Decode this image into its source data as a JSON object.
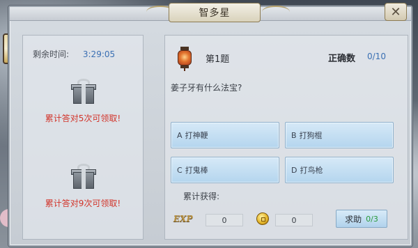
{
  "window": {
    "title": "智多星",
    "close_glyph": "✕"
  },
  "left_panel": {
    "timer_label": "剩余时间:",
    "timer_value": "3:29:05",
    "rewards": [
      {
        "icon": "gift-box-icon",
        "text": "累计答对5次可领取!"
      },
      {
        "icon": "silver-gift-box-icon",
        "text": "累计答对9次可领取!"
      }
    ]
  },
  "question": {
    "icon": "lantern-icon",
    "number_label": "第1题",
    "correct_label": "正确数",
    "correct_value": "0/10",
    "text": "姜子牙有什么法宝?"
  },
  "answers": [
    {
      "letter": "A",
      "text": "打神鞭"
    },
    {
      "letter": "B",
      "text": "打狗棍"
    },
    {
      "letter": "C",
      "text": "打鬼棒"
    },
    {
      "letter": "D",
      "text": "打鸟枪"
    }
  ],
  "accumulated": {
    "label": "累计获得:",
    "exp_label": "EXP",
    "exp_value": "0",
    "coin_icon": "copper-coin-icon",
    "coin_value": "0"
  },
  "help_button": {
    "label": "求助",
    "count": "0/3"
  },
  "colors": {
    "reward_text": "#d2342a",
    "accent_blue": "#3a6fb3",
    "help_count_green": "#2a9a3a"
  }
}
